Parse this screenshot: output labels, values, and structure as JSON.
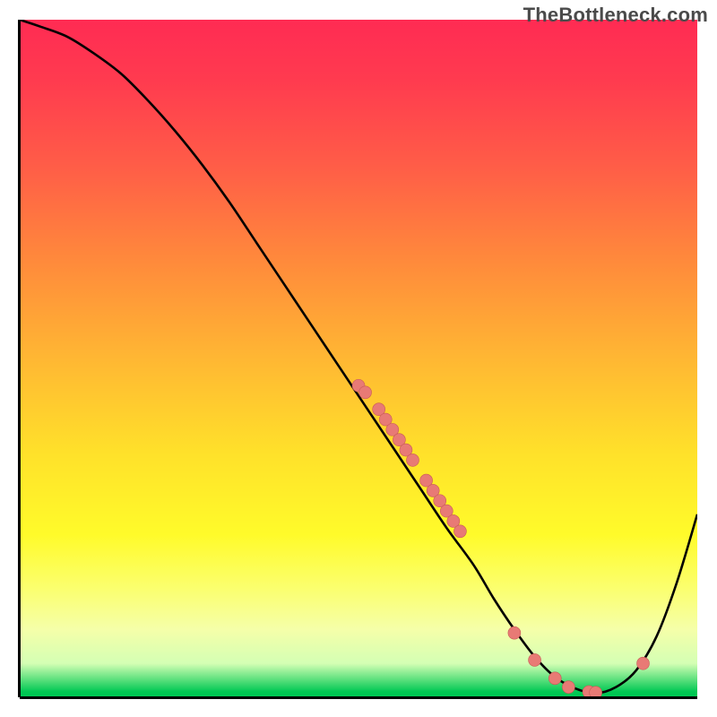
{
  "watermark": "TheBottleneck.com",
  "colors": {
    "curve": "#000000",
    "marker": "#e87a75",
    "marker_stroke": "#c85b56",
    "gradient_top": "#ff2b53",
    "gradient_bottom": "#00c853"
  },
  "chart_data": {
    "type": "line",
    "title": "",
    "xlabel": "",
    "ylabel": "",
    "xlim": [
      0,
      100
    ],
    "ylim": [
      0,
      100
    ],
    "curve": {
      "x": [
        0,
        3,
        7,
        11,
        15,
        19,
        23,
        27,
        31,
        35,
        39,
        43,
        47,
        51,
        55,
        59,
        63,
        67,
        70,
        73,
        76,
        79,
        82,
        85,
        88,
        91,
        94,
        97,
        100
      ],
      "y": [
        100,
        99,
        97.5,
        95,
        92,
        88,
        83.5,
        78.5,
        73,
        67,
        61,
        55,
        49,
        43,
        37,
        31,
        25,
        19.5,
        14.5,
        10,
        6,
        3,
        1.3,
        0.6,
        1.5,
        4,
        9,
        17,
        27
      ]
    },
    "markers": {
      "x": [
        50,
        51,
        53,
        54,
        55,
        56,
        57,
        58,
        60,
        61,
        62,
        63,
        64,
        65,
        73,
        76,
        79,
        81,
        84,
        85,
        92
      ],
      "y": [
        46,
        45,
        42.5,
        41,
        39.5,
        38,
        36.5,
        35,
        32,
        30.5,
        29,
        27.5,
        26,
        24.5,
        9.5,
        5.5,
        2.8,
        1.5,
        0.8,
        0.7,
        5.0
      ]
    }
  }
}
